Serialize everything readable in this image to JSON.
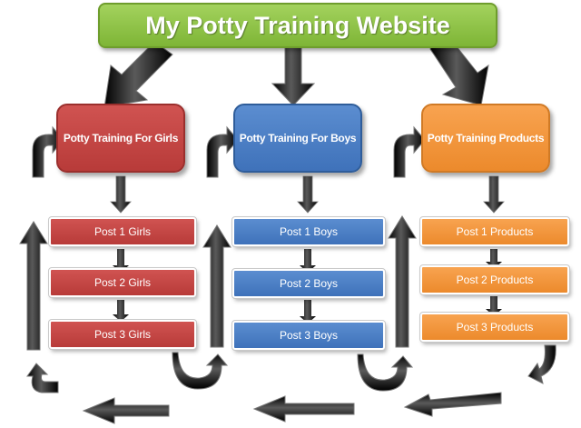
{
  "title": "My Potty Training Website",
  "columns": [
    {
      "heading": "Potty Training For Girls",
      "color": "#c0443f",
      "posts": [
        "Post 1 Girls",
        "Post 2 Girls",
        "Post 3 Girls"
      ]
    },
    {
      "heading": "Potty Training For Boys",
      "color": "#4a7cc2",
      "posts": [
        "Post 1 Boys",
        "Post 2 Boys",
        "Post 3 Boys"
      ]
    },
    {
      "heading": "Potty Training Products",
      "color": "#f39439",
      "posts": [
        "Post 1 Products",
        "Post 2 Products",
        "Post 3 Products"
      ]
    }
  ],
  "title_color": "#8cc63f",
  "arrow_color": "#1a1a1a"
}
